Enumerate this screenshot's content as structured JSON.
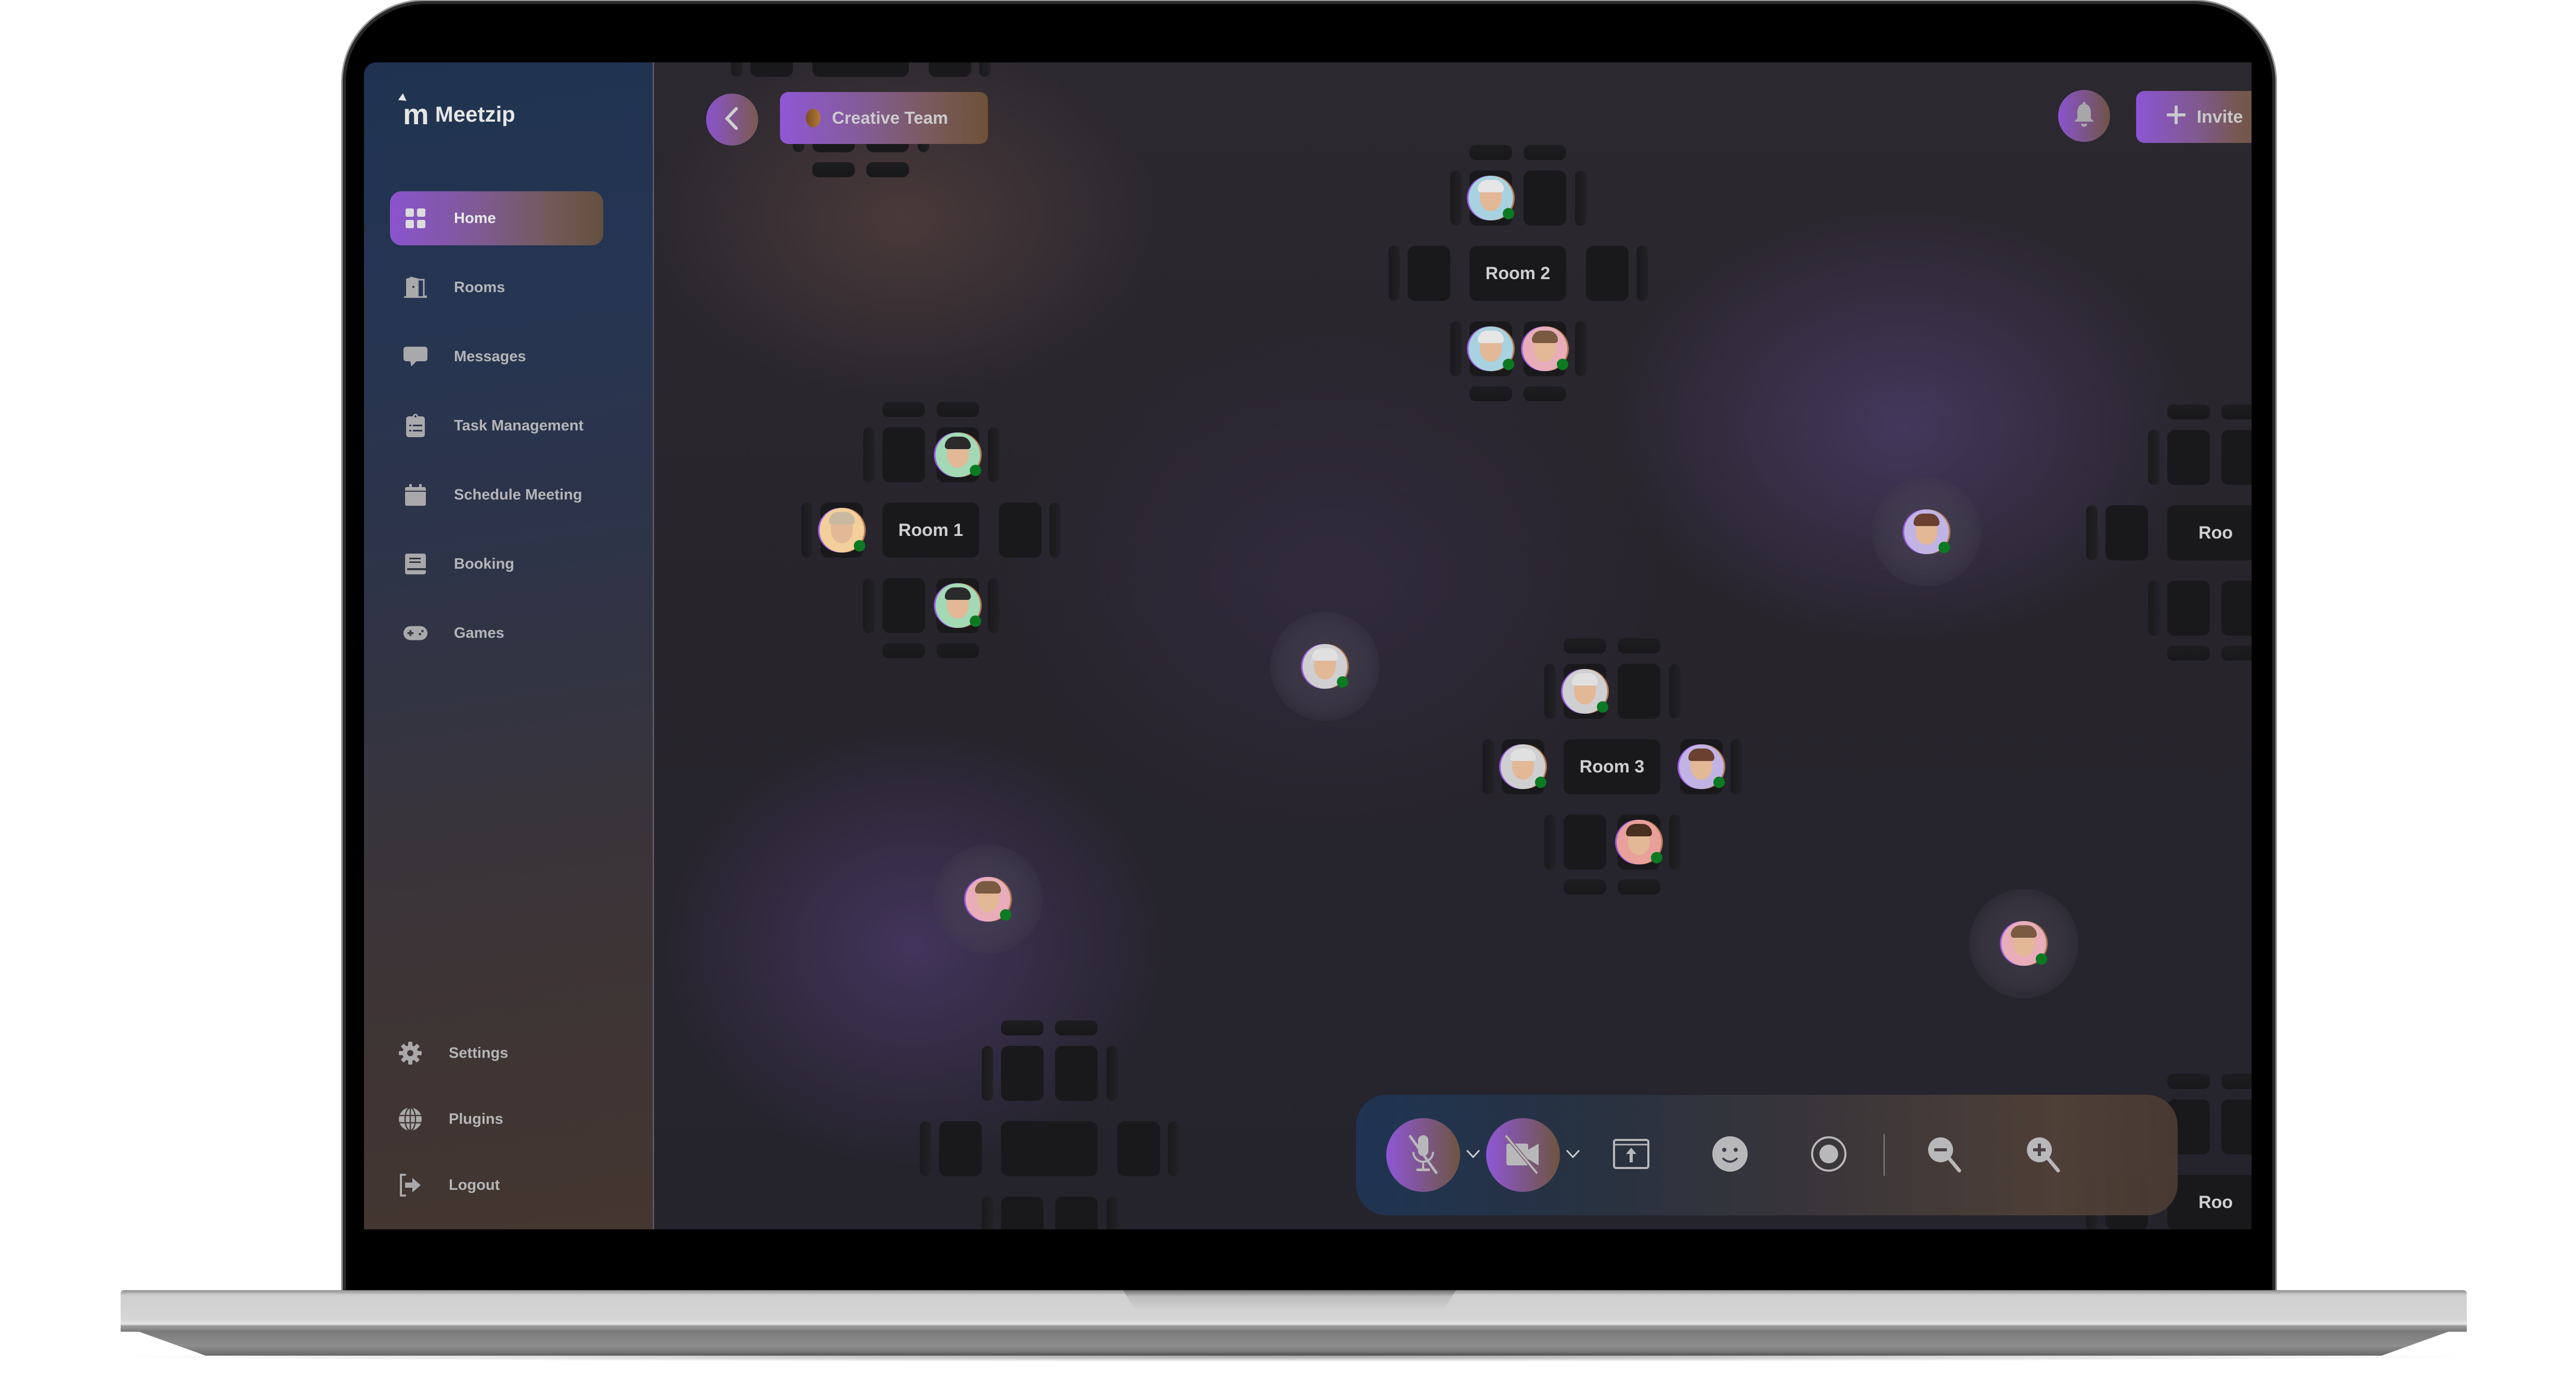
{
  "app": {
    "name": "Meetzip"
  },
  "sidebar": {
    "items": [
      {
        "label": "Home",
        "icon": "grid-icon",
        "active": true
      },
      {
        "label": "Rooms",
        "icon": "door-icon",
        "active": false
      },
      {
        "label": "Messages",
        "icon": "chat-bubble-icon",
        "active": false
      },
      {
        "label": "Task Management",
        "icon": "clipboard-list-icon",
        "active": false
      },
      {
        "label": "Schedule Meeting",
        "icon": "calendar-icon",
        "active": false
      },
      {
        "label": "Booking",
        "icon": "book-icon",
        "active": false
      },
      {
        "label": "Games",
        "icon": "gamepad-icon",
        "active": false
      }
    ],
    "bottom_items": [
      {
        "label": "Settings",
        "icon": "gear-icon"
      },
      {
        "label": "Plugins",
        "icon": "globe-icon"
      },
      {
        "label": "Logout",
        "icon": "logout-icon"
      }
    ]
  },
  "header": {
    "back_icon": "chevron-left-icon",
    "team_label": "Creative Team",
    "notification_icon": "bell-icon",
    "invite_label": "Invite",
    "invite_icon": "plus-icon",
    "profile_status": "online"
  },
  "rooms": [
    {
      "label": "Room 1",
      "seats": {
        "top": [
          "empty",
          "green"
        ],
        "left": "peach",
        "right": "empty",
        "bottom": [
          "empty",
          "green"
        ]
      }
    },
    {
      "label": "Room 2",
      "seats": {
        "top": [
          "blue",
          "empty"
        ],
        "left": "empty",
        "right": "empty",
        "bottom": [
          "blue",
          "pink"
        ]
      }
    },
    {
      "label": "Room 3",
      "seats": {
        "top": [
          "grey",
          "empty"
        ],
        "left": "grey",
        "right": "lavender",
        "bottom": [
          "empty",
          "salmon"
        ]
      }
    },
    {
      "label": "Roo"
    },
    {
      "label": "Roo"
    }
  ],
  "floating_users": [
    {
      "color": "grey",
      "status": "online"
    },
    {
      "color": "pink",
      "status": "online"
    },
    {
      "color": "lavender",
      "status": "online"
    },
    {
      "color": "pink",
      "status": "online"
    }
  ],
  "toolbar": {
    "buttons": [
      {
        "name": "mic-muted",
        "icon": "microphone-off-icon",
        "state": "muted"
      },
      {
        "name": "mic-options",
        "icon": "chevron-down-icon"
      },
      {
        "name": "camera-off",
        "icon": "video-off-icon",
        "state": "off"
      },
      {
        "name": "camera-options",
        "icon": "chevron-down-icon"
      },
      {
        "name": "share-screen",
        "icon": "screen-share-icon"
      },
      {
        "name": "reactions",
        "icon": "smiley-icon"
      },
      {
        "name": "record",
        "icon": "record-icon"
      },
      {
        "name": "zoom-out",
        "icon": "zoom-out-icon"
      },
      {
        "name": "zoom-in",
        "icon": "zoom-in-icon"
      }
    ]
  },
  "colors": {
    "accent_start": "#8f57d6",
    "accent_end": "#6d5238",
    "online": "#0c7a22",
    "avatar_bg": {
      "green": "#a3d9b5",
      "peach": "#f3cf9c",
      "blue": "#a9d2e0",
      "pink": "#e8adb9",
      "grey": "#cfcfd1",
      "lavender": "#c1b4e4",
      "salmon": "#e8a09a"
    }
  }
}
